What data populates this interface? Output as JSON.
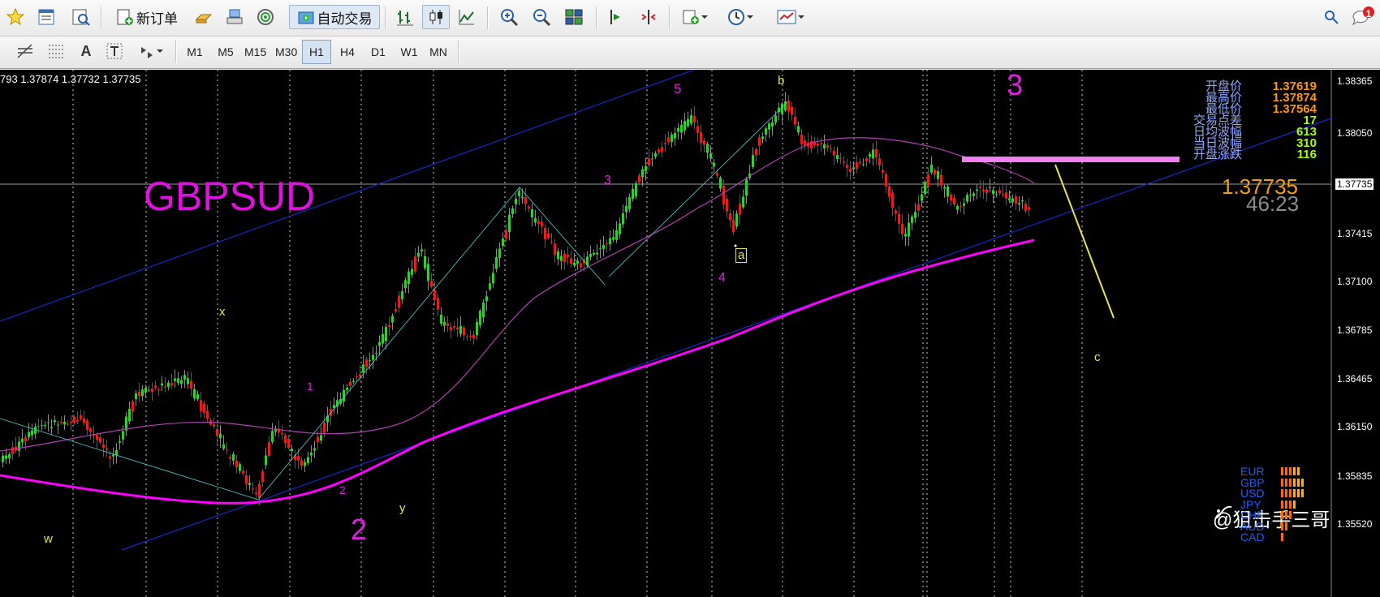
{
  "toolbar": {
    "new_order_label": "新订单",
    "auto_trade_label": "自动交易",
    "notification_count": "1",
    "colors": {
      "auto_trade_active_border": "#9fb5cf"
    }
  },
  "timeframes": [
    "M1",
    "M5",
    "M15",
    "M30",
    "H1",
    "H4",
    "D1",
    "W1",
    "MN"
  ],
  "active_timeframe": "H1",
  "draw_tools": [
    "A"
  ],
  "chart": {
    "ohlc_header": "793 1.37874 1.37732 1.37735",
    "symbol_label": "GBPSUD",
    "current_price": "1.37735",
    "bar_timer": "46:23",
    "price_axis": [
      "1.38365",
      "1.38050",
      "1.37735",
      "1.37415",
      "1.37100",
      "1.36785",
      "1.36465",
      "1.36150",
      "1.35835",
      "1.35520"
    ],
    "wave_labels": {
      "w": "w",
      "x": "x",
      "y": "y",
      "n1": "1",
      "n2": "2",
      "n3": "3",
      "n4": "4",
      "n5": "5",
      "a": "a",
      "b": "b",
      "c": "c",
      "big2": "2",
      "big3": "3"
    },
    "stats": [
      {
        "label": "开盘价",
        "value": "1.37619",
        "color": "#ff9900"
      },
      {
        "label": "最高价",
        "value": "1.37874",
        "color": "#ff9900"
      },
      {
        "label": "最低价",
        "value": "1.37564",
        "color": "#ff9900"
      },
      {
        "label": "交易点差",
        "value": "17",
        "color": "#a6ff00"
      },
      {
        "label": "日均波幅",
        "value": "613",
        "color": "#a6ff00"
      },
      {
        "label": "当日波幅",
        "value": "310",
        "color": "#a6ff00"
      },
      {
        "label": "开盘涨跌",
        "value": "116",
        "color": "#a6ff00"
      }
    ],
    "currency_strength": [
      {
        "code": "EUR",
        "level": 5
      },
      {
        "code": "GBP",
        "level": 6
      },
      {
        "code": "USD",
        "level": 6
      },
      {
        "code": "JPY",
        "level": 4
      },
      {
        "code": "CHF",
        "level": 3
      },
      {
        "code": "AUD",
        "level": 2
      },
      {
        "code": "CAD",
        "level": 1
      }
    ],
    "watermark": "@狙击手三哥",
    "colors": {
      "background": "#000000",
      "bull": "#33cc33",
      "bear": "#e61e1e",
      "symbol_text": "#e010e0",
      "ma_long": "#ff00ff",
      "ma_short": "#b040b0",
      "channel": "#1428c8",
      "resistance_zone": "#f080f0",
      "projection": "#e6e650"
    }
  }
}
